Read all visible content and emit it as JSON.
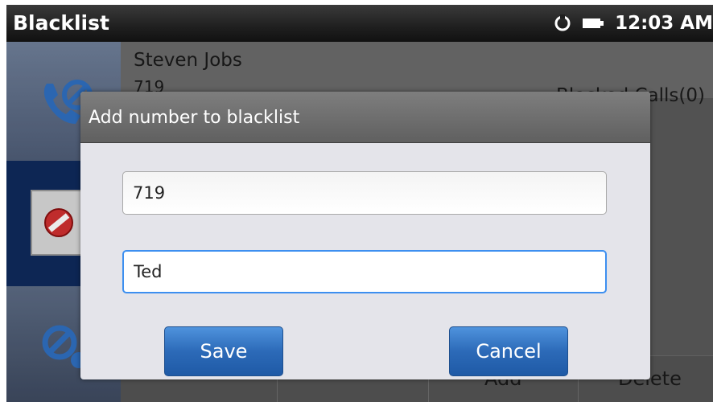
{
  "statusbar": {
    "title": "Blacklist",
    "time": "12:03 AM",
    "icons": [
      "sync-icon",
      "battery-icon"
    ]
  },
  "background": {
    "contact_name": "Steven Jobs",
    "contact_number": "719",
    "calls_label": "Blocked Calls(0)",
    "bottom_buttons": [
      "Add",
      "Delete"
    ],
    "side_tabs": [
      "call-block-icon",
      "blacklist-icon",
      "settings-icon"
    ]
  },
  "dialog": {
    "title": "Add number to blacklist",
    "number_value": "719",
    "name_value": "Ted",
    "save_label": "Save",
    "cancel_label": "Cancel"
  },
  "colors": {
    "accent": "#3d8ff0",
    "button": "#2c6ab8",
    "selected_tab": "#0f2a5c"
  }
}
